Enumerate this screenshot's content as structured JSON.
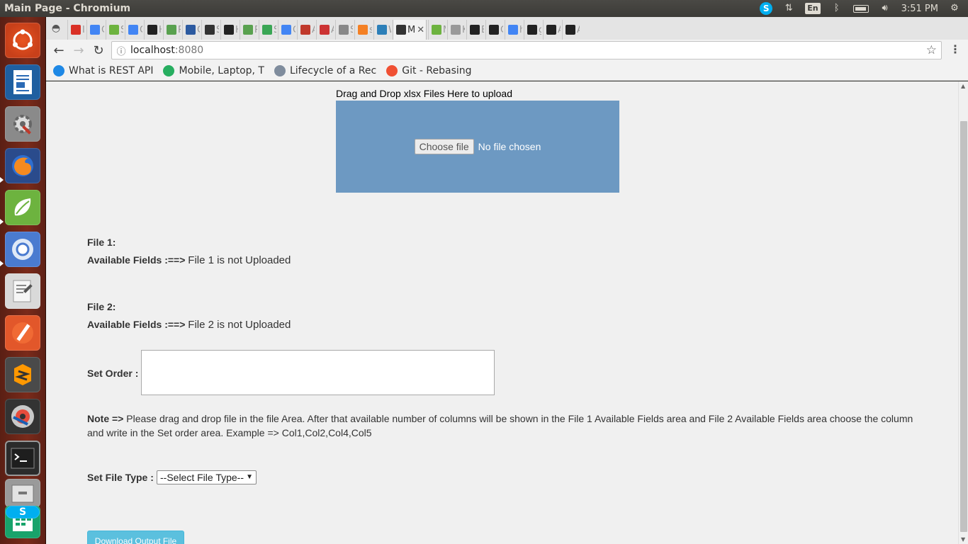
{
  "window": {
    "title": "Main Page - Chromium"
  },
  "panel": {
    "lang": "En",
    "time": "3:51 PM"
  },
  "tabs": [
    {
      "icon": "gmail-icon",
      "text": "In",
      "color": "#d93025"
    },
    {
      "icon": "docs-icon",
      "text": "C",
      "color": "#4285f4"
    },
    {
      "icon": "spring-icon",
      "text": "S",
      "color": "#6db33f"
    },
    {
      "icon": "google-icon",
      "text": "C",
      "color": "#4285f4"
    },
    {
      "icon": "github-icon",
      "text": "H",
      "color": "#222222"
    },
    {
      "icon": "jrebel-icon",
      "text": "R",
      "color": "#59a14f"
    },
    {
      "icon": "jira-icon",
      "text": "C",
      "color": "#2c5aa0"
    },
    {
      "icon": "square-icon",
      "text": "S",
      "color": "#333333"
    },
    {
      "icon": "github-icon",
      "text": "H",
      "color": "#222222"
    },
    {
      "icon": "jrebel-icon",
      "text": "R",
      "color": "#59a14f"
    },
    {
      "icon": "leaf-icon",
      "text": "S",
      "color": "#3aa655"
    },
    {
      "icon": "google-icon",
      "text": "C",
      "color": "#4285f4"
    },
    {
      "icon": "docs-icon",
      "text": "A",
      "color": "#c0392b"
    },
    {
      "icon": "alert-icon",
      "text": "A",
      "color": "#cc3333"
    },
    {
      "icon": "list-icon",
      "text": "S",
      "color": "#888888"
    },
    {
      "icon": "stack-icon",
      "text": "s",
      "color": "#f48024"
    },
    {
      "icon": "puzzle-icon",
      "text": "W",
      "color": "#2c7fb8"
    },
    {
      "icon": "medium-icon",
      "text": "M",
      "color": "#333333",
      "active": true
    },
    {
      "icon": "spring-icon",
      "text": "M",
      "color": "#6db33f"
    },
    {
      "icon": "k-icon",
      "text": "K",
      "color": "#999999"
    },
    {
      "icon": "github-icon",
      "text": "E",
      "color": "#222222"
    },
    {
      "icon": "github-icon",
      "text": "C",
      "color": "#222222"
    },
    {
      "icon": "google-icon",
      "text": "h",
      "color": "#4285f4"
    },
    {
      "icon": "github-icon",
      "text": "g",
      "color": "#222222"
    },
    {
      "icon": "github-icon",
      "text": "A",
      "color": "#222222"
    },
    {
      "icon": "github-icon",
      "text": "A",
      "color": "#222222"
    }
  ],
  "active_tab_label": "M",
  "address": {
    "host": "localhost",
    "port": ":8080"
  },
  "bookmarks": [
    {
      "label": "What is REST API",
      "icon": "medium-icon",
      "color": "#1e88e5"
    },
    {
      "label": "Mobile, Laptop, T",
      "icon": "bird-icon",
      "color": "#27ae60"
    },
    {
      "label": "Lifecycle of a Rec",
      "icon": "hexagon-icon",
      "color": "#7f8c9d"
    },
    {
      "label": "Git - Rebasing",
      "icon": "git-icon",
      "color": "#f05033"
    }
  ],
  "page": {
    "drop_label": "Drag and Drop xlsx Files Here to upload",
    "choose_file": "Choose file",
    "no_file": "No file chosen",
    "file1_label": "File 1:",
    "file1_fields_label": "Available Fields :==>",
    "file1_fields_value": "File 1 is not Uploaded",
    "file2_label": "File 2:",
    "file2_fields_label": "Available Fields :==>",
    "file2_fields_value": "File 2 is not Uploaded",
    "set_order_label": "Set Order :",
    "note_label": "Note =>",
    "note_text": "Please drag and drop file in the file Area. After that available number of columns will be shown in the File 1 Available Fields area and File 2 Available Fields area choose the column and write in the Set order area. Example => Col1,Col2,Col4,Col5",
    "file_type_label": "Set File Type :",
    "file_type_selected": "--Select File Type--",
    "download_button": "Download Output File"
  },
  "colors": {
    "drop_zone": "#6d99c2",
    "download_button": "#5bc0de",
    "launcher": "#7a2a1a"
  }
}
